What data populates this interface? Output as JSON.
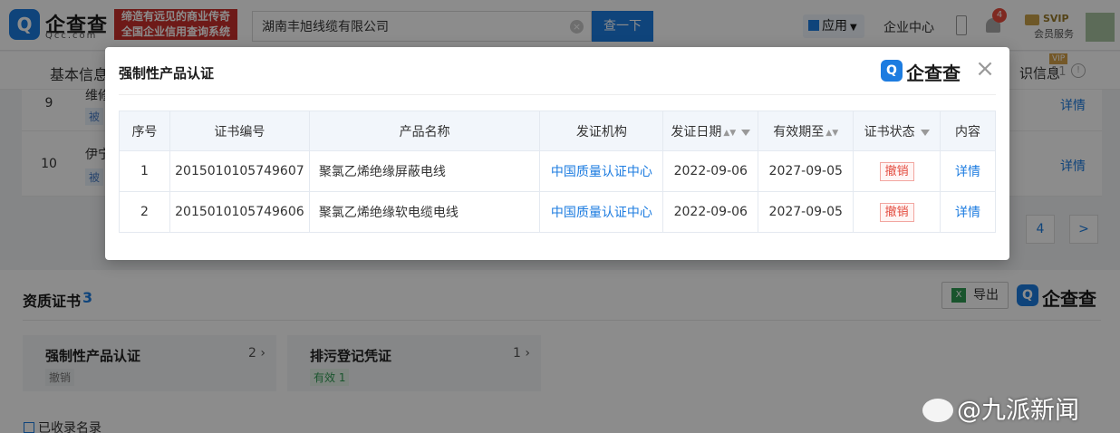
{
  "header": {
    "logo_main": "企查查",
    "logo_sub": "Qcc.com",
    "slogan_line1": "缔造有远见的商业传奇",
    "slogan_line2": "全国企业信用查询系统",
    "search_value": "湖南丰旭线缆有限公司",
    "search_button": "查一下",
    "app_label": "应用",
    "enterprise_center": "企业中心",
    "notification_count": "4",
    "svip_label": "SVIP",
    "member_service": "会员服务"
  },
  "tabs": {
    "basic_info": "基本信息",
    "right_tab": "识信息",
    "right_tab_count": "11",
    "vip_badge": "VIP"
  },
  "background_rows": [
    {
      "index": "9",
      "name": "维修",
      "tag": "被",
      "detail": "详情"
    },
    {
      "index": "10",
      "name": "伊宁",
      "tag": "被",
      "detail": "详情"
    }
  ],
  "pagination": {
    "page": "4",
    "next": ">"
  },
  "qualification": {
    "title": "资质证书",
    "count": "3",
    "export": "导出",
    "logo": "企查查",
    "cards": [
      {
        "title": "强制性产品认证",
        "count": "2",
        "status": "撤销",
        "status_color": "#777777",
        "status_bg": "#eceef1"
      },
      {
        "title": "排污登记凭证",
        "count": "1",
        "status": "有效 1",
        "status_color": "#2f9a52",
        "status_bg": "#e6f5ea"
      }
    ],
    "footer": "已收录名录"
  },
  "modal": {
    "title": "强制性产品认证",
    "logo": "企查查",
    "close": "×",
    "columns": [
      "序号",
      "证书编号",
      "产品名称",
      "发证机构",
      "发证日期",
      "有效期至",
      "证书状态",
      "内容"
    ],
    "rows": [
      {
        "index": "1",
        "cert_no": "2015010105749607",
        "product": "聚氯乙烯绝缘屏蔽电线",
        "issuer": "中国质量认证中心",
        "issue_date": "2022-09-06",
        "expiry": "2027-09-05",
        "status": "撤销",
        "content": "详情"
      },
      {
        "index": "2",
        "cert_no": "2015010105749606",
        "product": "聚氯乙烯绝缘软电缆电线",
        "issuer": "中国质量认证中心",
        "issue_date": "2022-09-06",
        "expiry": "2027-09-05",
        "status": "撤销",
        "content": "详情"
      }
    ]
  },
  "watermark": "@九派新闻",
  "colors": {
    "brand_blue": "#1d7ce0",
    "revoked_red": "#e34b3e",
    "slogan_red": "#c9302c"
  }
}
